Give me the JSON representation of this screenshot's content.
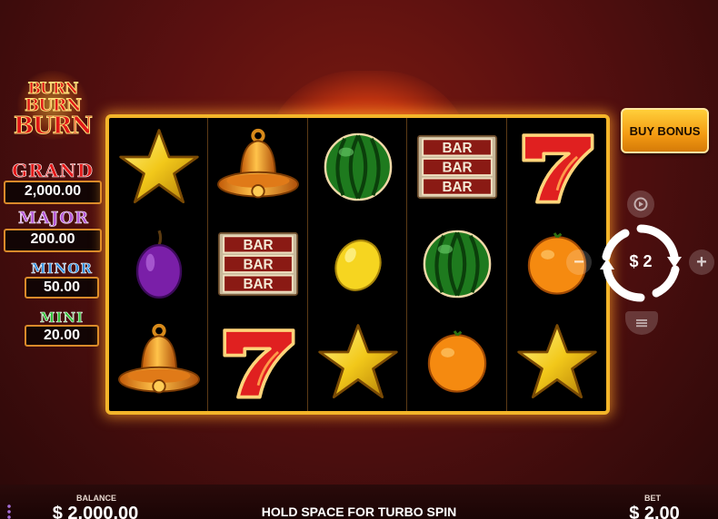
{
  "logo": {
    "line1": "BURN",
    "line2": "BURN",
    "line3": "BURN"
  },
  "jackpots": {
    "grand": {
      "label": "GRAND",
      "value": "2,000.00"
    },
    "major": {
      "label": "MAJOR",
      "value": "200.00"
    },
    "minor": {
      "label": "MINOR",
      "value": "50.00"
    },
    "mini": {
      "label": "MINI",
      "value": "20.00"
    }
  },
  "reels": [
    [
      "star",
      "plum",
      "bell"
    ],
    [
      "bell",
      "bar",
      "seven"
    ],
    [
      "watermelon",
      "lemon",
      "star"
    ],
    [
      "bar",
      "watermelon",
      "orange"
    ],
    [
      "seven",
      "orange",
      "star"
    ]
  ],
  "bar_symbol_text": "BAR",
  "controls": {
    "buy_bonus_label": "BUY BONUS",
    "spin_bet_label": "$ 2",
    "minus_label": "−",
    "plus_label": "+"
  },
  "bottom": {
    "balance_label": "BALANCE",
    "balance_value": "$ 2,000.00",
    "turbo_hint": "HOLD SPACE FOR TURBO SPIN",
    "bet_label": "BET",
    "bet_value": "$ 2.00"
  },
  "colors": {
    "background": "#5a1010",
    "reel_frame": "#f3b52a",
    "grand": "#e41a1a",
    "major": "#b65ad8",
    "minor": "#2f8fe0",
    "mini": "#32c23a",
    "buy_bonus": "#f39a12"
  }
}
